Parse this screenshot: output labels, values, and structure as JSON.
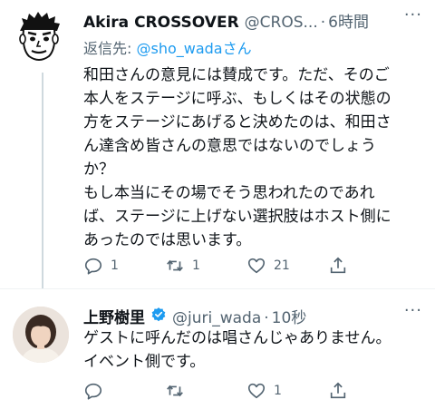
{
  "tweets": [
    {
      "display_name": "Akira CROSSOVER",
      "handle": "@CROS...",
      "separator": "·",
      "time": "6時間",
      "more": "···",
      "reply_prefix": "返信先: ",
      "reply_handle": "@sho_wada",
      "reply_suffix": "さん",
      "body_lines": [
        "和田さんの意見には賛成です。ただ、そのご",
        "本人をステージに呼ぶ、もしくはその状態の",
        "方をステージにあげると決めたのは、和田さ",
        "ん達含め皆さんの意思ではないのでしょう",
        "か？",
        "もし本当にその場でそう思われたのであれ",
        "ば、ステージに上げない選択肢はホスト側に",
        "あったのでは思います。"
      ],
      "counts": {
        "reply": "1",
        "retweet": "1",
        "like": "21",
        "share": ""
      }
    },
    {
      "display_name": "上野樹里",
      "handle": "@juri_wada",
      "separator": "·",
      "time": "10秒",
      "more": "···",
      "body_lines": [
        "ゲストに呼んだのは唱さんじゃありません。",
        "イベント側です。"
      ],
      "counts": {
        "reply": "",
        "retweet": "",
        "like": "1",
        "share": ""
      }
    }
  ],
  "icons": [
    "reply-icon",
    "retweet-icon",
    "like-icon",
    "share-icon",
    "verified-badge-icon",
    "more-icon"
  ],
  "colors": {
    "text": "#0f1419",
    "secondary": "#536471",
    "link": "#1d9bf0",
    "thread_line": "#cfd9de"
  }
}
